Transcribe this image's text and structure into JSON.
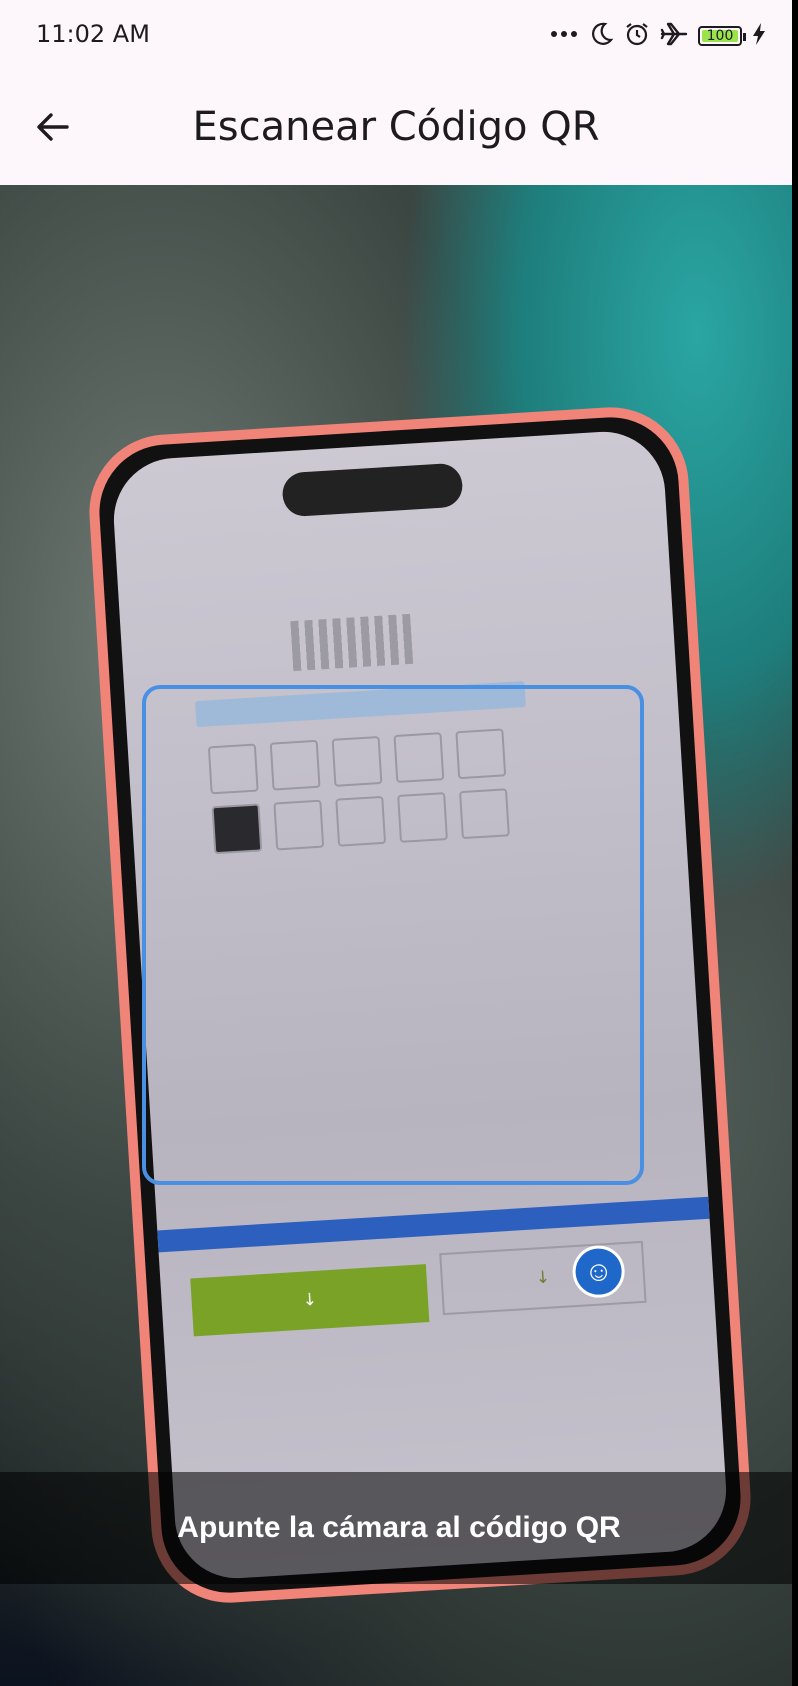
{
  "status_bar": {
    "time": "11:02 AM",
    "battery_level": "100",
    "icons": [
      "more-dots-icon",
      "moon-icon",
      "alarm-icon",
      "airplane-icon",
      "battery-icon",
      "charging-bolt-icon"
    ]
  },
  "app_bar": {
    "title": "Escanear Código QR",
    "back_icon": "back-arrow-icon"
  },
  "scanner": {
    "instruction": "Apunte la cámara al código QR",
    "frame_color": "#4a90e2"
  }
}
